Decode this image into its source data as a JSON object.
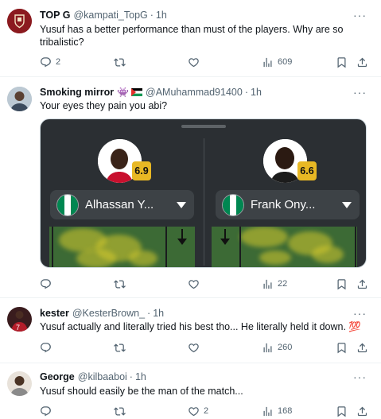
{
  "tweets": [
    {
      "name": "TOP G",
      "handle": "@kampati_TopG",
      "time": "1h",
      "text": "Yusuf has a better performance than must of the  players. Why are so tribalistic?",
      "replies": "2",
      "retweets": "",
      "likes": "",
      "views": "609"
    },
    {
      "name": "Smoking mirror",
      "name_emoji": "👾",
      "handle": "@AMuhammad91400",
      "time": "1h",
      "text": "Your eyes they pain you abi?",
      "replies": "",
      "retweets": "",
      "likes": "",
      "views": "22",
      "media": {
        "players": [
          {
            "name": "Alhassan Y...",
            "rating": "6.9"
          },
          {
            "name": "Frank Ony...",
            "rating": "6.6"
          }
        ]
      }
    },
    {
      "name": "kester",
      "handle": "@KesterBrown_",
      "time": "1h",
      "text": "Yusuf actually and literally tried his best tho... He literally held it down. 💯",
      "replies": "",
      "retweets": "",
      "likes": "",
      "views": "260"
    },
    {
      "name": "George",
      "handle": "@kilbaaboi",
      "time": "1h",
      "text": "Yusuf should easily be the man of the match...",
      "replies": "",
      "retweets": "",
      "likes": "2",
      "views": "168"
    }
  ],
  "dot": "·",
  "more_label": "···",
  "colors": {
    "accent_rating": "#e8b824",
    "nigeria_green": "#008751",
    "text_secondary": "#536471"
  }
}
